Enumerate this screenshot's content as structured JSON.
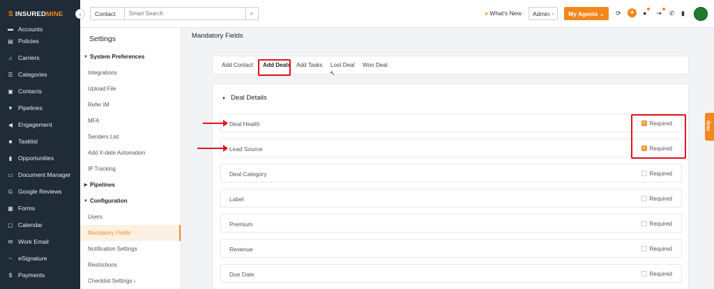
{
  "app": {
    "logo": {
      "mark": "S",
      "name_part1": "INSURED",
      "name_part2": "MINE"
    },
    "collapse_glyph": "‹",
    "colors": {
      "accent": "#f2871b",
      "sidebar_bg": "#1f2b36",
      "highlight": "#e3111b",
      "avatar": "#1d7a2e"
    }
  },
  "sidebar": {
    "items": [
      {
        "label": "Accounts",
        "icon": "accounts-icon",
        "glyph": "▬"
      },
      {
        "label": "Policies",
        "icon": "policies-icon",
        "glyph": "▤"
      },
      {
        "label": "Carriers",
        "icon": "carriers-icon",
        "glyph": "⌂"
      },
      {
        "label": "Categories",
        "icon": "categories-icon",
        "glyph": "☰"
      },
      {
        "label": "Contacts",
        "icon": "contacts-icon",
        "glyph": "▣"
      },
      {
        "label": "Pipelines",
        "icon": "pipelines-icon",
        "glyph": "▼"
      },
      {
        "label": "Engagement",
        "icon": "engagement-icon",
        "glyph": "◀"
      },
      {
        "label": "Tasklist",
        "icon": "tasklist-icon",
        "glyph": "■"
      },
      {
        "label": "Opportunities",
        "icon": "opportunities-icon",
        "glyph": "▮"
      },
      {
        "label": "Document Manager",
        "icon": "folder-icon",
        "glyph": "▭"
      },
      {
        "label": "Google Reviews",
        "icon": "google-icon",
        "glyph": "G"
      },
      {
        "label": "Forms",
        "icon": "forms-icon",
        "glyph": "▦"
      },
      {
        "label": "Calendar",
        "icon": "calendar-icon",
        "glyph": "▢"
      },
      {
        "label": "Work Email",
        "icon": "email-icon",
        "glyph": "✉"
      },
      {
        "label": "eSignature",
        "icon": "signature-icon",
        "glyph": "~"
      },
      {
        "label": "Payments",
        "icon": "payments-icon",
        "glyph": "$"
      }
    ]
  },
  "topbar": {
    "contact_select": "Contact",
    "search_placeholder": "Smart Search",
    "search_glyph": "⌕",
    "whats_new": "What's New",
    "flame_glyph": "●",
    "admin_select": "Admin",
    "chevron_glyph": "⌄",
    "agents_button": "My Agents ⌄",
    "refresh_glyph": "⟳",
    "plus_glyph": "+",
    "bell_glyph": "●",
    "exit_glyph": "⇥",
    "phone_glyph": "✆",
    "clipboard_glyph": "▮"
  },
  "settings": {
    "title": "Settings",
    "tri_open": "▼",
    "tri_closed": "▶",
    "sections": [
      {
        "label": "System Preferences"
      },
      {
        "label": "Pipelines"
      },
      {
        "label": "Configuration"
      }
    ],
    "items": {
      "integrations": "Integrations",
      "upload_file": "Upload File",
      "refer_im": "Refer IM",
      "mfa": "MFA",
      "senders_list": "Senders List",
      "add_xdate": "Add X-date Automation",
      "ip_tracking": "IP Tracking",
      "users": "Users",
      "mandatory_fields": "Mandatory Fields",
      "notification_settings": "Notification Settings",
      "restrictions": "Restrictions",
      "checklist_settings": "Checklist Settings ›"
    }
  },
  "main": {
    "title": "Mandatory Fields",
    "tabs": [
      {
        "label": "Add Contact"
      },
      {
        "label": "Add Deals"
      },
      {
        "label": "Add Tasks"
      },
      {
        "label": "Lost Deal"
      },
      {
        "label": "Won Deal"
      }
    ],
    "cursor_glyph": "↖",
    "section_title": "Deal Details",
    "check_glyph": "✓",
    "fields": [
      {
        "label": "Deal Health",
        "required_label": "Required",
        "required": true
      },
      {
        "label": "Lead Source",
        "required_label": "Required",
        "required": true
      },
      {
        "label": "Deal Category",
        "required_label": "Required",
        "required": false
      },
      {
        "label": "Label",
        "required_label": "Required",
        "required": false
      },
      {
        "label": "Premium",
        "required_label": "Required",
        "required": false
      },
      {
        "label": "Revenue",
        "required_label": "Required",
        "required": false
      },
      {
        "label": "Due Date",
        "required_label": "Required",
        "required": false
      }
    ]
  },
  "help": {
    "label": "Help",
    "glyph": "?"
  }
}
